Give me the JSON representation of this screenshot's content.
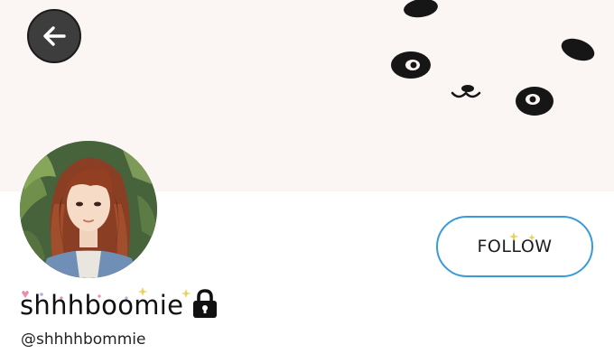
{
  "header": {
    "back_button_icon": "arrow-left-icon",
    "banner_theme": "panda-face",
    "banner_color": "#fbf5f3"
  },
  "profile": {
    "display_name": "shhhboomie",
    "handle": "@shhhhbommie",
    "locked_icon": "lock-icon",
    "avatar": "profile-photo"
  },
  "actions": {
    "follow_label": "FOLLOW",
    "follow_border_color": "#3a9ad9"
  }
}
